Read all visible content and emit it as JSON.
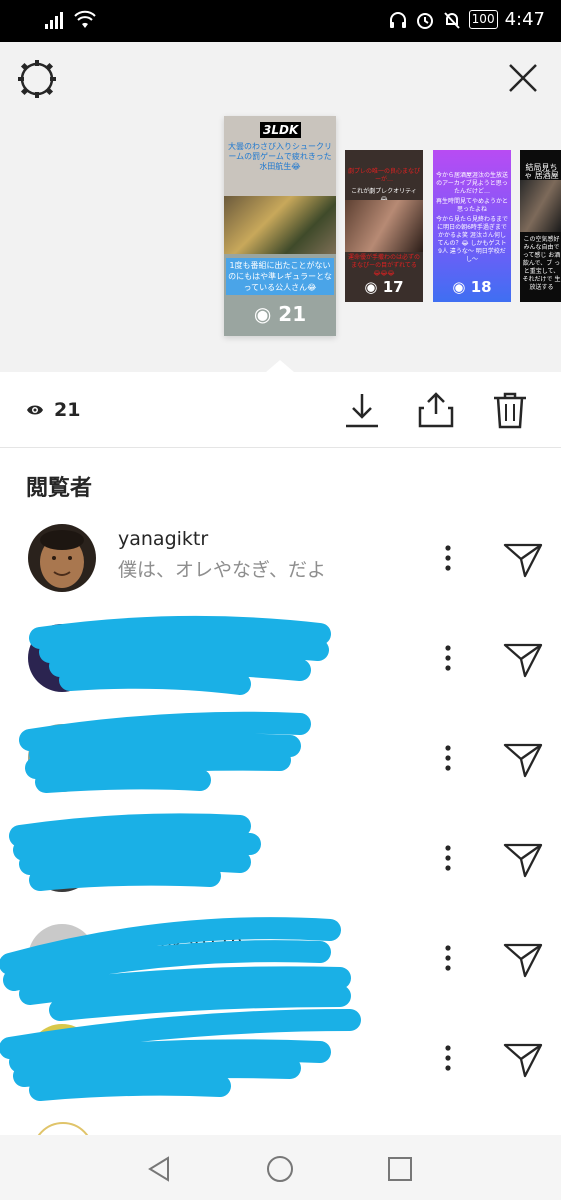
{
  "status_bar": {
    "battery": "100",
    "time": "4:47"
  },
  "header": {
    "settings_icon": "gear-icon",
    "close_icon": "close-icon"
  },
  "stories": {
    "main": {
      "tag": "3LDK",
      "caption_top": "大曇のわさび入りシュークリームの罰ゲームで疲れきった水田航生😂",
      "caption_bottom": "1度も番組に出たことがないのにもはや準レギュラーとなっている公人さん😂",
      "views": "21"
    },
    "thumbs": [
      {
        "text_top": "劇プレの唯一の良心まなぴーが…",
        "text_mid": "これが劇プレクオリティ😂",
        "text_bottom": "運命優が手撒わのは必ずのまなぴーの目がずれてる😂😂😂",
        "views": "17"
      },
      {
        "text_top": "今から居酒屋涯汰の生放送のアーカイブ見ようと思ったんだけど…",
        "text_mid": "再生時間見てやめようかと思ったよね",
        "text_bottom": "今から見たら見終わるまでに明日の朝6時手過ぎまでかかるよ笑 涯汰さん何してんの？😂 しかもゲスト9人 違うな〜 明日学校だし～",
        "views": "18"
      },
      {
        "text_top": "結局見ちゃ 居酒屋",
        "text_bottom": "この空気感好 みんな自由で って感じ お酒飲んで、ブ っと重宝して、 それだけで 生放送する"
      }
    ]
  },
  "actions": {
    "views": "21",
    "eye_icon": "eye-icon",
    "download_icon": "download-icon",
    "share_icon": "share-icon",
    "delete_icon": "trash-icon"
  },
  "viewers_title": "閲覧者",
  "viewers": [
    {
      "username": "yanagiktr",
      "fullname": "僕は、オレやなぎ、だよ",
      "avatar_color": "#7a5a43",
      "hidden": false
    },
    {
      "username": "",
      "fullname": "",
      "avatar_color": "#2b2450",
      "hidden": true
    },
    {
      "username": "",
      "fullname": "",
      "avatar_color": "#9aa48a",
      "hidden": true
    },
    {
      "username": "",
      "fullname": "",
      "avatar_color": "#3a3a3a",
      "hidden": true
    },
    {
      "username": "nka0119",
      "fullname": "",
      "avatar_color": "#c9c9c9",
      "hidden": true
    },
    {
      "username": "",
      "fullname": "",
      "avatar_color": "#d8c84a",
      "hidden": true
    }
  ],
  "scribble_color": "#1ab0e6",
  "nav": {
    "back_icon": "back-triangle-icon",
    "home_icon": "home-circle-icon",
    "recents_icon": "recents-square-icon"
  }
}
